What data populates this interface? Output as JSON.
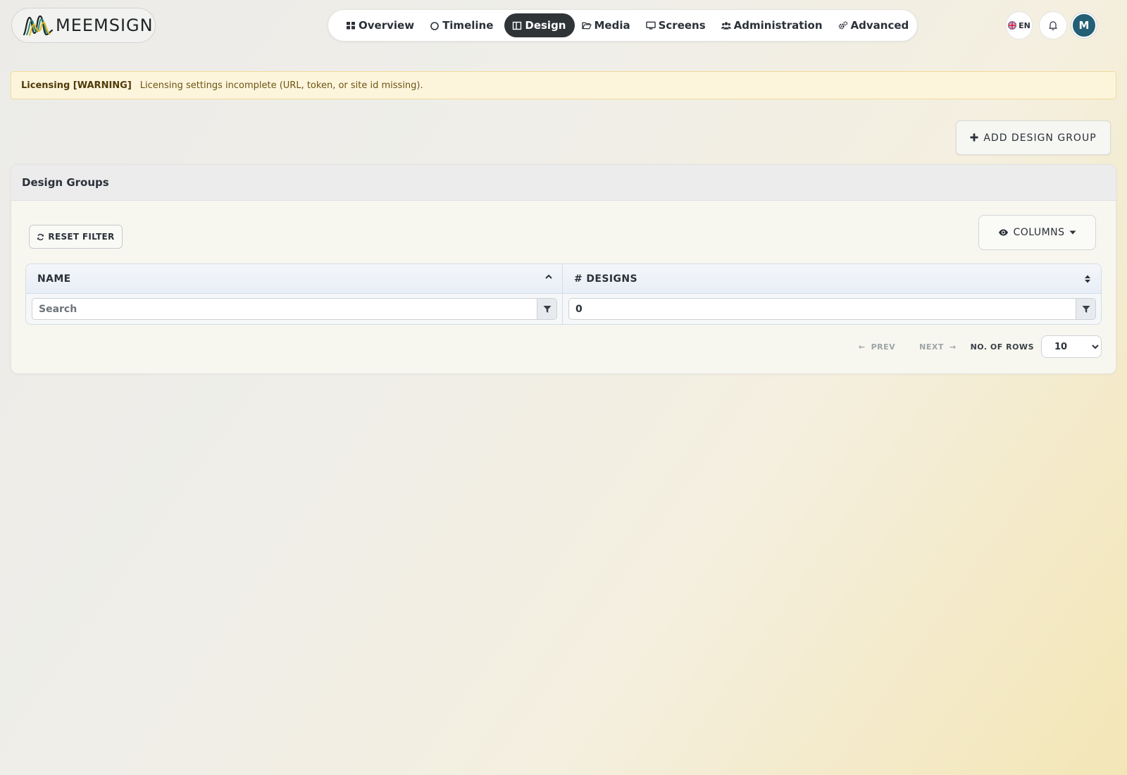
{
  "brand": {
    "name": "MEEMSIGN"
  },
  "nav": {
    "items": [
      {
        "label": "Overview",
        "icon": "grid-icon"
      },
      {
        "label": "Timeline",
        "icon": "circle-icon"
      },
      {
        "label": "Design",
        "icon": "layout-icon",
        "active": true
      },
      {
        "label": "Media",
        "icon": "folder-icon"
      },
      {
        "label": "Screens",
        "icon": "monitor-icon"
      },
      {
        "label": "Administration",
        "icon": "users-icon"
      },
      {
        "label": "Advanced",
        "icon": "gears-icon"
      }
    ],
    "active_color": "#2f3436"
  },
  "header": {
    "language": "EN",
    "avatar_initial": "M",
    "avatar_color": "#235f75"
  },
  "alert": {
    "title": "Licensing [WARNING]",
    "message": "Licensing settings incomplete (URL, token, or site id missing)."
  },
  "actions": {
    "add_design_group": "ADD DESIGN GROUP"
  },
  "card": {
    "title": "Design Groups",
    "reset_filter": "RESET FILTER",
    "columns_button": "COLUMNS"
  },
  "table": {
    "columns": [
      {
        "label": "NAME",
        "sort": "asc",
        "filter_placeholder": "Search",
        "filter_value": ""
      },
      {
        "label": "# DESIGNS",
        "sort": "none",
        "filter_placeholder": "",
        "filter_value": "0"
      }
    ],
    "rows": []
  },
  "pagination": {
    "prev": "PREV",
    "next": "NEXT",
    "rows_label": "NO. OF ROWS",
    "rows_value": "10"
  }
}
